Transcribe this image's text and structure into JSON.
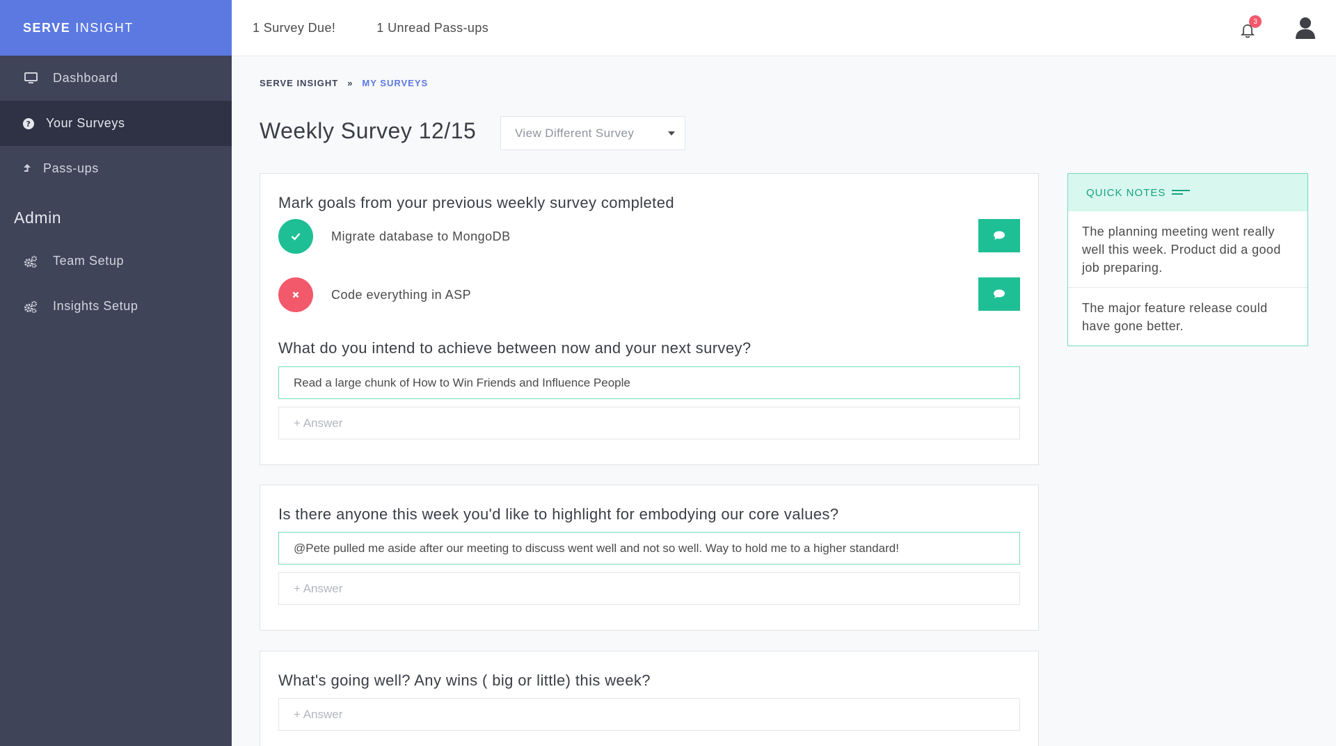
{
  "brand": {
    "bold": "SERVE",
    "light": "INSIGHT"
  },
  "sidebar": {
    "items": [
      {
        "label": "Dashboard",
        "icon": "monitor-icon"
      },
      {
        "label": "Your Surveys",
        "icon": "question-circle-icon"
      },
      {
        "label": "Pass-ups",
        "icon": "arrow-up-icon"
      }
    ],
    "admin_label": "Admin",
    "admin_items": [
      {
        "label": "Team Setup",
        "icon": "cogs-icon"
      },
      {
        "label": "Insights Setup",
        "icon": "cogs-icon"
      }
    ]
  },
  "topbar": {
    "survey_due": "1 Survey Due!",
    "unread_passups": "1 Unread Pass-ups",
    "notification_count": "3"
  },
  "breadcrumb": {
    "root": "SERVE INSIGHT",
    "separator": "»",
    "current": "MY SURVEYS"
  },
  "page": {
    "title": "Weekly Survey 12/15",
    "selector_label": "View Different Survey"
  },
  "survey": {
    "card1": {
      "goals_title": "Mark goals from your previous weekly survey completed",
      "goals": [
        {
          "text": "Migrate database to MongoDB",
          "status": "completed"
        },
        {
          "text": "Code everything in ASP",
          "status": "not-completed"
        }
      ],
      "intend_title": "What do you intend to achieve between now and your next survey?",
      "intend_answer": "Read a large chunk of How to Win Friends and Influence People",
      "answer_placeholder": "+ Answer"
    },
    "card2": {
      "title": "Is there anyone this week you'd like to highlight for embodying our core values?",
      "answer": "@Pete pulled me aside after our meeting to discuss went well and not so well. Way to hold me to a higher standard!",
      "answer_placeholder": "+ Answer"
    },
    "card3": {
      "title": "What's going well? Any wins ( big or little) this week?",
      "answer_placeholder": "+ Answer"
    }
  },
  "quick_notes": {
    "title": "QUICK NOTES",
    "notes": [
      "The planning meeting went really well this week. Product did a good job preparing.",
      "The major feature release could have gone better."
    ]
  },
  "colors": {
    "sidebar": "#3f4459",
    "brand": "#5b79e1",
    "accent_green": "#1fbf95",
    "danger_red": "#f2596a"
  }
}
